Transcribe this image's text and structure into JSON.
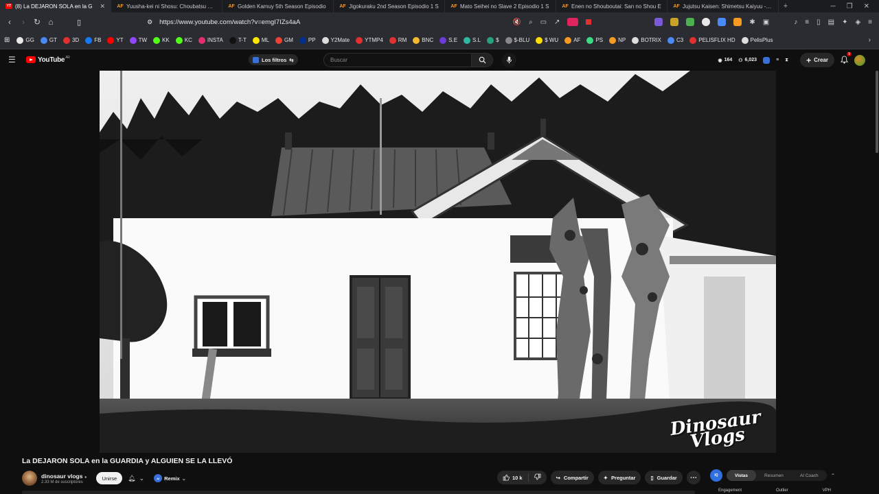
{
  "browser": {
    "tabs": [
      {
        "title": "(8) La DEJARON SOLA en la G",
        "favicon": "YT",
        "active": true
      },
      {
        "title": "Yuusha-kei ni Shosu: Choubatsu Yuu",
        "favicon": "AF",
        "active": false
      },
      {
        "title": "Golden Kamuy 5th Season Episodio",
        "favicon": "AF",
        "active": false
      },
      {
        "title": "Jigokuraku 2nd Season Episodio 1 S",
        "favicon": "AF",
        "active": false
      },
      {
        "title": "Mato Seihei no Slave 2 Episodio 1 S",
        "favicon": "AF",
        "active": false
      },
      {
        "title": "Enen no Shouboutai: San no Shou E",
        "favicon": "AF",
        "active": false
      },
      {
        "title": "Jujutsu Kaisen: Shimetsu Kaiyuu - Zo",
        "favicon": "AF",
        "active": false
      }
    ],
    "new_tab": "+",
    "url": "https://www.youtube.com/watch?v=emgI7IZs4aA",
    "bookmarks": [
      {
        "label": "GG",
        "color": "#e8e8e8"
      },
      {
        "label": "GT",
        "color": "#4a8af4"
      },
      {
        "label": "3D",
        "color": "#e03030"
      },
      {
        "label": "FB",
        "color": "#1877f2"
      },
      {
        "label": "YT",
        "color": "#ff0000"
      },
      {
        "label": "TW",
        "color": "#9146ff"
      },
      {
        "label": "KK",
        "color": "#53fc18"
      },
      {
        "label": "KC",
        "color": "#53fc18"
      },
      {
        "label": "INSTA",
        "color": "#e1306c"
      },
      {
        "label": "T-T",
        "color": "#111111"
      },
      {
        "label": "ML",
        "color": "#ffe600"
      },
      {
        "label": "GM",
        "color": "#ea4335"
      },
      {
        "label": "PP",
        "color": "#003087"
      },
      {
        "label": "Y2Mate",
        "color": "#dddddd"
      },
      {
        "label": "YTMP4",
        "color": "#e03030"
      },
      {
        "label": "RM",
        "color": "#e03030"
      },
      {
        "label": "BNC",
        "color": "#f3ba2f"
      },
      {
        "label": "S.E",
        "color": "#6c3bd8"
      },
      {
        "label": "S.L",
        "color": "#2fb7a0"
      },
      {
        "label": "$",
        "color": "#26a17b"
      },
      {
        "label": "$-BLU",
        "color": "#888888"
      },
      {
        "label": "$ WU",
        "color": "#ffdd00"
      },
      {
        "label": "AF",
        "color": "#f59a23"
      },
      {
        "label": "PS",
        "color": "#3ddc84"
      },
      {
        "label": "NP",
        "color": "#f59a23"
      },
      {
        "label": "BOTRIX",
        "color": "#dddddd"
      },
      {
        "label": "C3",
        "color": "#4a8af4"
      },
      {
        "label": "PELISFLIX HD",
        "color": "#e03030"
      },
      {
        "label": "PelisPlus",
        "color": "#dddddd"
      }
    ]
  },
  "youtube": {
    "logo_text": "YouTube",
    "logo_country": "AR",
    "filters_label": "Los filtros",
    "search_placeholder": "Buscar",
    "stat_1": "164",
    "stat_2": "6,023",
    "create_label": "Crear",
    "notif_count": "9",
    "video": {
      "title": "La DEJARON SOLA en la GUARDIA y ALGUIEN SE LA LLEVÓ",
      "watermark_line1": "Dinosaur",
      "watermark_line2": "Vlogs"
    },
    "channel": {
      "name": "dinosaur vlogs",
      "subscribers": "2.33 M de suscriptores",
      "join_label": "Unirse",
      "remix_label": "Remix"
    },
    "actions": {
      "likes": "10 k",
      "share": "Compartir",
      "ask": "Preguntar",
      "save": "Guardar"
    },
    "analytics": {
      "logo": "IQ",
      "tabs": [
        "Vistas",
        "Resumen",
        "AI Coach"
      ],
      "sub_labels": [
        "Engagement",
        "Outlier",
        "VPH"
      ]
    }
  }
}
